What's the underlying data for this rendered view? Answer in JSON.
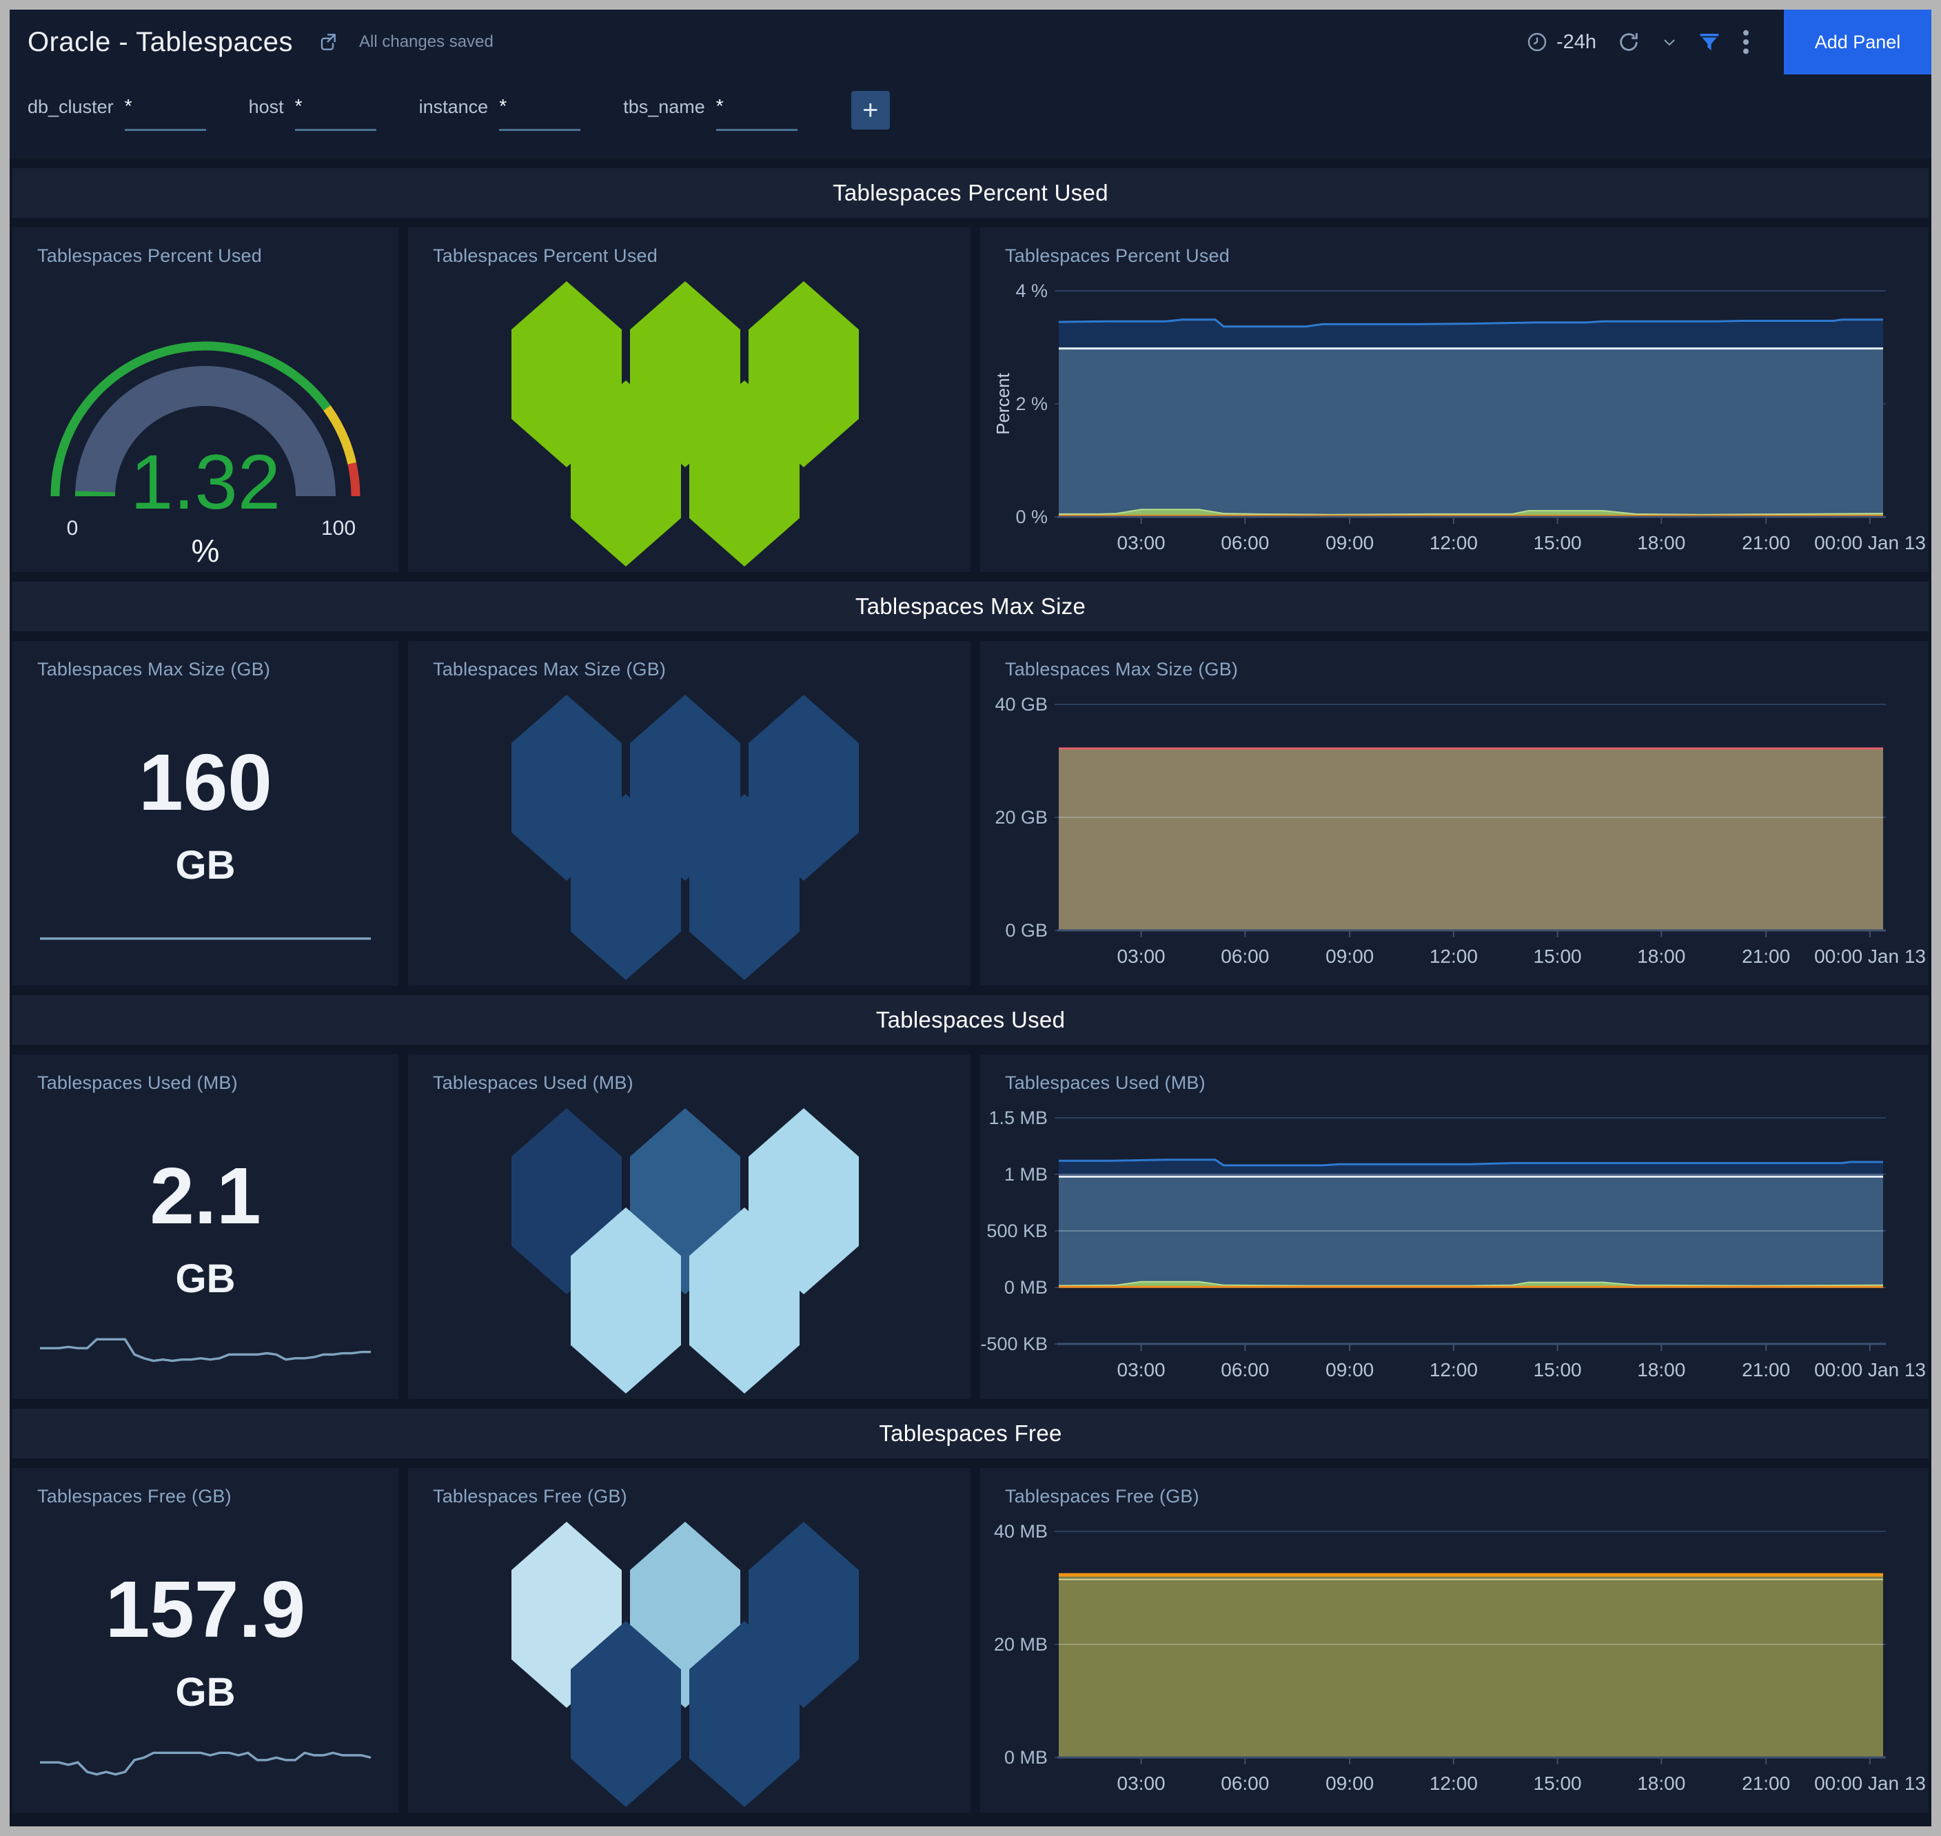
{
  "header": {
    "title": "Oracle - Tablespaces",
    "status": "All changes saved",
    "time_range": "-24h",
    "add_panel_label": "Add Panel"
  },
  "filters": {
    "items": [
      {
        "label": "db_cluster",
        "value": "*"
      },
      {
        "label": "host",
        "value": "*"
      },
      {
        "label": "instance",
        "value": "*"
      },
      {
        "label": "tbs_name",
        "value": "*"
      }
    ],
    "add_label": "+"
  },
  "rows": [
    {
      "section_title": "Tablespaces Percent Used",
      "left_title": "Tablespaces Percent Used",
      "mid_title": "Tablespaces Percent Used",
      "right_title": "Tablespaces Percent Used"
    },
    {
      "section_title": "Tablespaces Max Size",
      "left_title": "Tablespaces Max Size (GB)",
      "value": "160",
      "unit": "GB",
      "mid_title": "Tablespaces Max Size (GB)",
      "right_title": "Tablespaces Max Size (GB)"
    },
    {
      "section_title": "Tablespaces Used",
      "left_title": "Tablespaces Used (MB)",
      "value": "2.1",
      "unit": "GB",
      "mid_title": "Tablespaces Used (MB)",
      "right_title": "Tablespaces Used (MB)"
    },
    {
      "section_title": "Tablespaces Free",
      "left_title": "Tablespaces Free (GB)",
      "value": "157.9",
      "unit": "GB",
      "mid_title": "Tablespaces Free (GB)",
      "right_title": "Tablespaces Free (GB)"
    }
  ],
  "gauge": {
    "display": "1.32",
    "value": 1.32,
    "min": 0,
    "max": 100,
    "min_label": "0",
    "max_label": "100",
    "unit": "%",
    "value_color": "#22a63e",
    "track_color": "#475878",
    "zones": [
      {
        "until": 80,
        "color": "#27a53e"
      },
      {
        "until": 93,
        "color": "#e3c129"
      },
      {
        "until": 100,
        "color": "#cf3a32"
      }
    ]
  },
  "hex_panels": [
    {
      "name": "percent-used-honeycomb",
      "colors": [
        "#79c20e",
        "#79c20e",
        "#79c20e",
        "#79c20e",
        "#79c20e"
      ]
    },
    {
      "name": "max-size-honeycomb",
      "colors": [
        "#1e4573",
        "#1e4573",
        "#1e4573",
        "#1e4573",
        "#1e4573"
      ]
    },
    {
      "name": "used-honeycomb",
      "colors": [
        "#1c3d6a",
        "#2e5f8c",
        "#a9d8ec",
        "#a9d8ec",
        "#a9d8ec"
      ]
    },
    {
      "name": "free-honeycomb",
      "colors": [
        "#bfe0ee",
        "#93c6dc",
        "#1e4573",
        "#1e4573",
        "#1e4573"
      ]
    }
  ],
  "sparklines": {
    "max_size": {
      "color": "#7fa3c0",
      "values": [
        160,
        160,
        160,
        160,
        160,
        160,
        160,
        160,
        160,
        160,
        160,
        160
      ]
    },
    "used": {
      "color": "#7fa3c0",
      "values": [
        2.05,
        2.05,
        2.05,
        2.06,
        2.05,
        2.05,
        2.12,
        2.12,
        2.12,
        2.12,
        2.0,
        1.97,
        1.95,
        1.96,
        1.95,
        1.96,
        1.96,
        1.97,
        1.96,
        1.97,
        2.0,
        2.0,
        2.0,
        2.0,
        2.01,
        2.0,
        1.96,
        1.97,
        1.97,
        1.98,
        2.0,
        2.0,
        2.01,
        2.01,
        2.02,
        2.02
      ]
    },
    "free": {
      "color": "#7fa3c0",
      "values": [
        157.8,
        157.8,
        157.8,
        157.7,
        157.8,
        157.4,
        157.3,
        157.4,
        157.3,
        157.4,
        157.9,
        158.0,
        158.2,
        158.2,
        158.2,
        158.2,
        158.2,
        158.2,
        158.1,
        158.2,
        158.2,
        158.1,
        158.2,
        157.9,
        157.9,
        158.0,
        157.9,
        157.9,
        158.2,
        158.1,
        158.1,
        158.2,
        158.1,
        158.1,
        158.1,
        158.0
      ]
    }
  },
  "chart_data": [
    {
      "id": "tablespaces-percent-used",
      "type": "area",
      "title": "Tablespaces Percent Used",
      "ylabel": "Percent",
      "ymin": 0,
      "ymax": 4,
      "gridlines": [
        {
          "v": 4,
          "label": "4 %"
        },
        {
          "v": 2,
          "label": "2 %"
        },
        {
          "v": 0,
          "label": "0 %"
        }
      ],
      "overlines": [],
      "x_ticks": [
        "03:00",
        "06:00",
        "09:00",
        "12:00",
        "15:00",
        "18:00",
        "21:00",
        "00:00 Jan 13"
      ],
      "series": [
        {
          "name": "high-band",
          "kind": "area",
          "base": 2.98,
          "fill": "#15315a",
          "line": "#2e7ad0",
          "width": 3,
          "points": [
            [
              0,
              3.45
            ],
            [
              0.06,
              3.46
            ],
            [
              0.13,
              3.46
            ],
            [
              0.15,
              3.49
            ],
            [
              0.19,
              3.49
            ],
            [
              0.2,
              3.37
            ],
            [
              0.3,
              3.37
            ],
            [
              0.32,
              3.41
            ],
            [
              0.43,
              3.41
            ],
            [
              0.5,
              3.42
            ],
            [
              0.58,
              3.44
            ],
            [
              0.64,
              3.44
            ],
            [
              0.66,
              3.46
            ],
            [
              0.8,
              3.46
            ],
            [
              0.83,
              3.47
            ],
            [
              0.94,
              3.47
            ],
            [
              0.95,
              3.49
            ],
            [
              1,
              3.49
            ]
          ]
        },
        {
          "name": "mid-band",
          "kind": "area",
          "base": 0,
          "fill": "#3b5c7c",
          "line": "#e4eef7",
          "width": 3,
          "points": [
            [
              0,
              2.98
            ],
            [
              1,
              2.98
            ]
          ]
        },
        {
          "name": "low-band",
          "kind": "area",
          "base": 0,
          "fill": "#8fbe69",
          "line": "#b9dc90",
          "width": 2,
          "points": [
            [
              0,
              0.05
            ],
            [
              0.05,
              0.05
            ],
            [
              0.07,
              0.06
            ],
            [
              0.1,
              0.13
            ],
            [
              0.17,
              0.13
            ],
            [
              0.2,
              0.06
            ],
            [
              0.24,
              0.05
            ],
            [
              0.33,
              0.04
            ],
            [
              0.45,
              0.05
            ],
            [
              0.55,
              0.05
            ],
            [
              0.57,
              0.11
            ],
            [
              0.66,
              0.11
            ],
            [
              0.7,
              0.05
            ],
            [
              0.78,
              0.04
            ],
            [
              0.9,
              0.05
            ],
            [
              1,
              0.06
            ]
          ]
        },
        {
          "name": "baseline",
          "kind": "line",
          "line": "#ed8a1e",
          "width": 3,
          "points": [
            [
              0,
              0.02
            ],
            [
              1,
              0.02
            ]
          ]
        }
      ]
    },
    {
      "id": "tablespaces-max-size",
      "type": "area",
      "title": "Tablespaces Max Size (GB)",
      "ylabel": "",
      "ymin": 0,
      "ymax": 40,
      "gridlines": [
        {
          "v": 40,
          "label": "40 GB"
        },
        {
          "v": 20,
          "label": "20 GB"
        },
        {
          "v": 0,
          "label": "0 GB"
        }
      ],
      "overlines": [
        20
      ],
      "x_ticks": [
        "03:00",
        "06:00",
        "09:00",
        "12:00",
        "15:00",
        "18:00",
        "21:00",
        "00:00 Jan 13"
      ],
      "series": [
        {
          "name": "max-size",
          "kind": "area",
          "base": 0,
          "fill": "#8a8164",
          "line": "#e65f6d",
          "width": 3,
          "points": [
            [
              0,
              32.2
            ],
            [
              1,
              32.2
            ]
          ]
        }
      ]
    },
    {
      "id": "tablespaces-used",
      "type": "area",
      "title": "Tablespaces Used (MB)",
      "ylabel": "",
      "ymin": -0.5,
      "ymax": 1.5,
      "gridlines": [
        {
          "v": 1.5,
          "label": "1.5 MB"
        },
        {
          "v": 1,
          "label": "1 MB"
        },
        {
          "v": 0.5,
          "label": "500 KB"
        },
        {
          "v": 0,
          "label": "0 MB"
        },
        {
          "v": -0.5,
          "label": "-500 KB"
        }
      ],
      "overlines": [
        1,
        0.5
      ],
      "x_ticks": [
        "03:00",
        "06:00",
        "09:00",
        "12:00",
        "15:00",
        "18:00",
        "21:00",
        "00:00 Jan 13"
      ],
      "series": [
        {
          "name": "high-band",
          "kind": "area",
          "base": 0.98,
          "fill": "#15315a",
          "line": "#2e7ad0",
          "width": 3,
          "points": [
            [
              0,
              1.12
            ],
            [
              0.06,
              1.12
            ],
            [
              0.13,
              1.13
            ],
            [
              0.19,
              1.13
            ],
            [
              0.2,
              1.08
            ],
            [
              0.32,
              1.08
            ],
            [
              0.34,
              1.09
            ],
            [
              0.5,
              1.09
            ],
            [
              0.55,
              1.1
            ],
            [
              0.7,
              1.1
            ],
            [
              0.8,
              1.1
            ],
            [
              0.95,
              1.1
            ],
            [
              0.96,
              1.11
            ],
            [
              1,
              1.11
            ]
          ]
        },
        {
          "name": "mid-band",
          "kind": "area",
          "base": 0,
          "fill": "#3b5c7c",
          "line": "#e4eef7",
          "width": 3,
          "points": [
            [
              0,
              0.98
            ],
            [
              1,
              0.98
            ]
          ]
        },
        {
          "name": "low-band",
          "kind": "area",
          "base": 0,
          "fill": "#8fbe69",
          "line": "#b9dc90",
          "width": 2,
          "points": [
            [
              0,
              0.015
            ],
            [
              0.07,
              0.02
            ],
            [
              0.1,
              0.05
            ],
            [
              0.17,
              0.05
            ],
            [
              0.2,
              0.02
            ],
            [
              0.3,
              0.015
            ],
            [
              0.5,
              0.015
            ],
            [
              0.55,
              0.02
            ],
            [
              0.57,
              0.045
            ],
            [
              0.66,
              0.045
            ],
            [
              0.7,
              0.02
            ],
            [
              0.85,
              0.015
            ],
            [
              1,
              0.02
            ]
          ]
        },
        {
          "name": "baseline",
          "kind": "line",
          "line": "#ed8a1e",
          "width": 3,
          "points": [
            [
              0,
              0.005
            ],
            [
              1,
              0.005
            ]
          ]
        }
      ]
    },
    {
      "id": "tablespaces-free",
      "type": "area",
      "title": "Tablespaces Free (GB)",
      "ylabel": "",
      "ymin": 0,
      "ymax": 40,
      "gridlines": [
        {
          "v": 40,
          "label": "40 MB"
        },
        {
          "v": 20,
          "label": "20 MB"
        },
        {
          "v": 0,
          "label": "0 MB"
        }
      ],
      "overlines": [
        20
      ],
      "x_ticks": [
        "03:00",
        "06:00",
        "09:00",
        "12:00",
        "15:00",
        "18:00",
        "21:00",
        "00:00 Jan 13"
      ],
      "series": [
        {
          "name": "free",
          "kind": "area",
          "base": 0,
          "fill": "#7d8048",
          "line": "#f09414",
          "width": 5,
          "points": [
            [
              0,
              32.3
            ],
            [
              1,
              32.3
            ]
          ]
        },
        {
          "name": "free-inner-line",
          "kind": "line",
          "line": "#ccd49b",
          "width": 2,
          "points": [
            [
              0,
              31.5
            ],
            [
              1,
              31.5
            ]
          ]
        }
      ]
    }
  ]
}
